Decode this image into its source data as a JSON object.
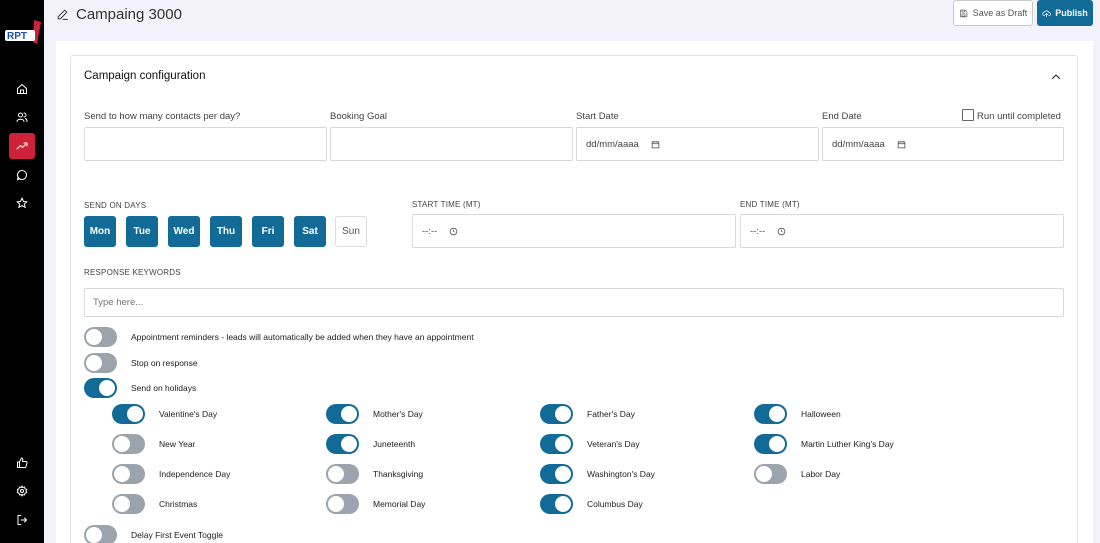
{
  "header": {
    "title": "Campaing 3000",
    "save_draft_label": "Save as Draft",
    "publish_label": "Publish"
  },
  "sidebar": {
    "logo_text": "RPT",
    "items": [
      "home-icon",
      "users-icon",
      "trending-up-icon",
      "chat-icon",
      "star-icon",
      "thumbs-up-icon",
      "gear-icon",
      "logout-icon"
    ],
    "active": "trending-up-icon"
  },
  "config": {
    "title": "Campaign configuration",
    "contacts_label": "Send to how many contacts per day?",
    "booking_label": "Booking Goal",
    "start_date_label": "Start Date",
    "end_date_label": "End Date",
    "date_placeholder": "dd/mm/aaaa",
    "run_until_label": "Run until completed",
    "send_days_label": "SEND ON DAYS",
    "days": [
      "Mon",
      "Tue",
      "Wed",
      "Thu",
      "Fri",
      "Sat",
      "Sun"
    ],
    "days_selected": [
      true,
      true,
      true,
      true,
      true,
      true,
      false
    ],
    "start_time_label": "START TIME (MT)",
    "end_time_label": "END TIME (MT)",
    "time_placeholder": "--:--",
    "keywords_label": "RESPONSE KEYWORDS",
    "keywords_placeholder": "Type here...",
    "options": [
      {
        "label": "Appointment reminders - leads will automatically be added when they have an appointment",
        "on": false
      },
      {
        "label": "Stop on response",
        "on": false
      },
      {
        "label": "Send on holidays",
        "on": true
      }
    ],
    "holidays": [
      {
        "label": "Valentine's Day",
        "on": true
      },
      {
        "label": "Mother's Day",
        "on": true
      },
      {
        "label": "Father's Day",
        "on": true
      },
      {
        "label": "Halloween",
        "on": true
      },
      {
        "label": "New Year",
        "on": false
      },
      {
        "label": "Juneteenth",
        "on": true
      },
      {
        "label": "Veteran's Day",
        "on": true
      },
      {
        "label": "Martin Luther King's Day",
        "on": true
      },
      {
        "label": "Independence Day",
        "on": false
      },
      {
        "label": "Thanksgiving",
        "on": false
      },
      {
        "label": "Washington's Day",
        "on": true
      },
      {
        "label": "Labor Day",
        "on": false
      },
      {
        "label": "Christmas",
        "on": false
      },
      {
        "label": "Memorial Day",
        "on": false
      },
      {
        "label": "Columbus Day",
        "on": true
      }
    ],
    "delay_label": "Delay First Event Toggle",
    "delay_on": false
  },
  "colors": {
    "accent": "#126b96",
    "sidebar": "#000000",
    "active_nav": "#d0213a",
    "toggle_off": "#9ba3ad"
  }
}
